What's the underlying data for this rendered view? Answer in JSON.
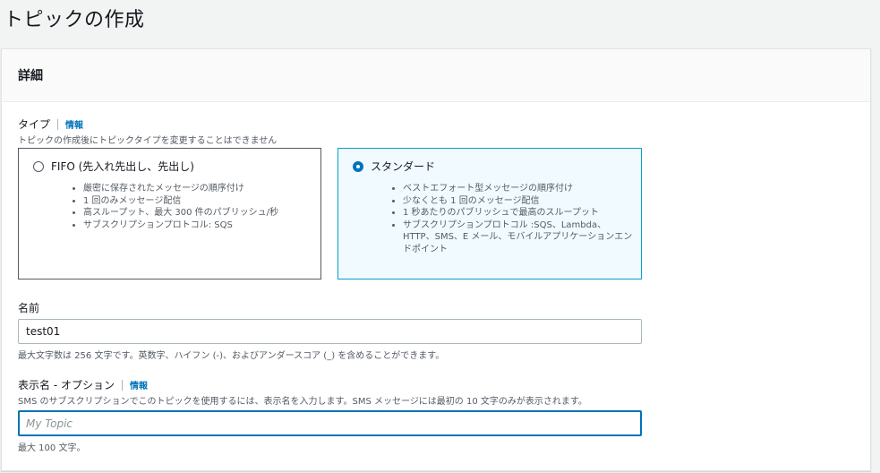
{
  "page": {
    "title": "トピックの作成"
  },
  "details": {
    "header": "詳細",
    "type": {
      "label": "タイプ",
      "info": "情報",
      "description": "トピックの作成後にトピックタイプを変更することはできません",
      "options": [
        {
          "label": "FIFO (先入れ先出し、先出し)",
          "selected": false,
          "bullets": [
            "厳密に保存されたメッセージの順序付け",
            "1 回のみメッセージ配信",
            "高スループット、最大 300 件のパブリッシュ/秒",
            "サブスクリプションプロトコル: SQS"
          ]
        },
        {
          "label": "スタンダード",
          "selected": true,
          "bullets": [
            "ベストエフォート型メッセージの順序付け",
            "少なくとも 1 回のメッセージ配信",
            "1 秒あたりのパブリッシュで最高のスループット",
            "サブスクリプションプロトコル :SQS、Lambda、HTTP、SMS、E メール、モバイルアプリケーションエンドポイント"
          ]
        }
      ]
    },
    "name": {
      "label": "名前",
      "value": "test01",
      "hint": "最大文字数は 256 文字です。英数字、ハイフン (-)、およびアンダースコア (_) を含めることができます。"
    },
    "display_name": {
      "label": "表示名 - オプション",
      "info": "情報",
      "description": "SMS のサブスクリプションでこのトピックを使用するには、表示名を入力します。SMS メッセージには最初の 10 文字のみが表示されます。",
      "placeholder": "My Topic",
      "hint": "最大 100 文字。"
    }
  },
  "colors": {
    "accent": "#0073bb",
    "selected_border": "#00a1c9",
    "selected_bg": "#f1faff"
  }
}
